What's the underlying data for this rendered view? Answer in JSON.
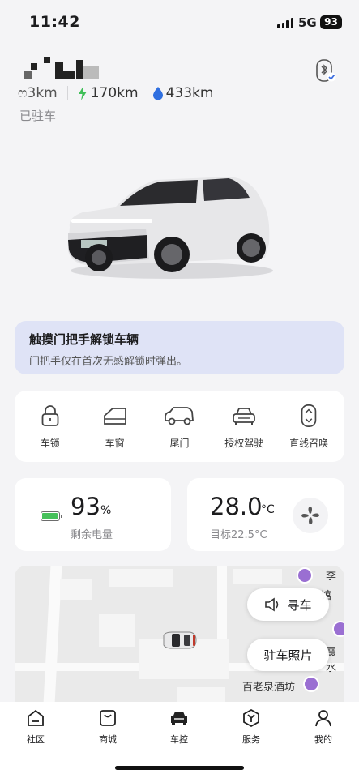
{
  "status_bar": {
    "time": "11:42",
    "network": "5G",
    "battery": "93"
  },
  "header": {
    "range_partial": "ෆ3km",
    "electric_range": "170km",
    "fuel_range": "433km",
    "parking_state": "已驻车"
  },
  "notice": {
    "title": "触摸门把手解锁车辆",
    "subtitle": "门把手仅在首次无感解锁时弹出。"
  },
  "quick_controls": [
    {
      "label": "车锁",
      "icon": "lock-icon"
    },
    {
      "label": "车窗",
      "icon": "window-icon"
    },
    {
      "label": "尾门",
      "icon": "tailgate-icon"
    },
    {
      "label": "授权驾驶",
      "icon": "car-front-icon"
    },
    {
      "label": "直线召唤",
      "icon": "summon-icon"
    }
  ],
  "battery_card": {
    "value": "93",
    "unit": "%",
    "label": "剩余电量",
    "level": 0.93,
    "color": "#46c05a"
  },
  "climate_card": {
    "value": "28.0",
    "unit": "°C",
    "label": "目标22.5°C"
  },
  "map": {
    "find_car": "寻车",
    "parking_photo": "驻车照片",
    "poi": [
      "李",
      "馆",
      "霞水",
      "百老泉酒坊"
    ]
  },
  "tab_bar": [
    {
      "label": "社区",
      "icon": "community-icon"
    },
    {
      "label": "商城",
      "icon": "shop-icon"
    },
    {
      "label": "车控",
      "icon": "car-control-icon"
    },
    {
      "label": "服务",
      "icon": "service-icon"
    },
    {
      "label": "我的",
      "icon": "profile-icon"
    }
  ],
  "accent": "#3e6fe0"
}
